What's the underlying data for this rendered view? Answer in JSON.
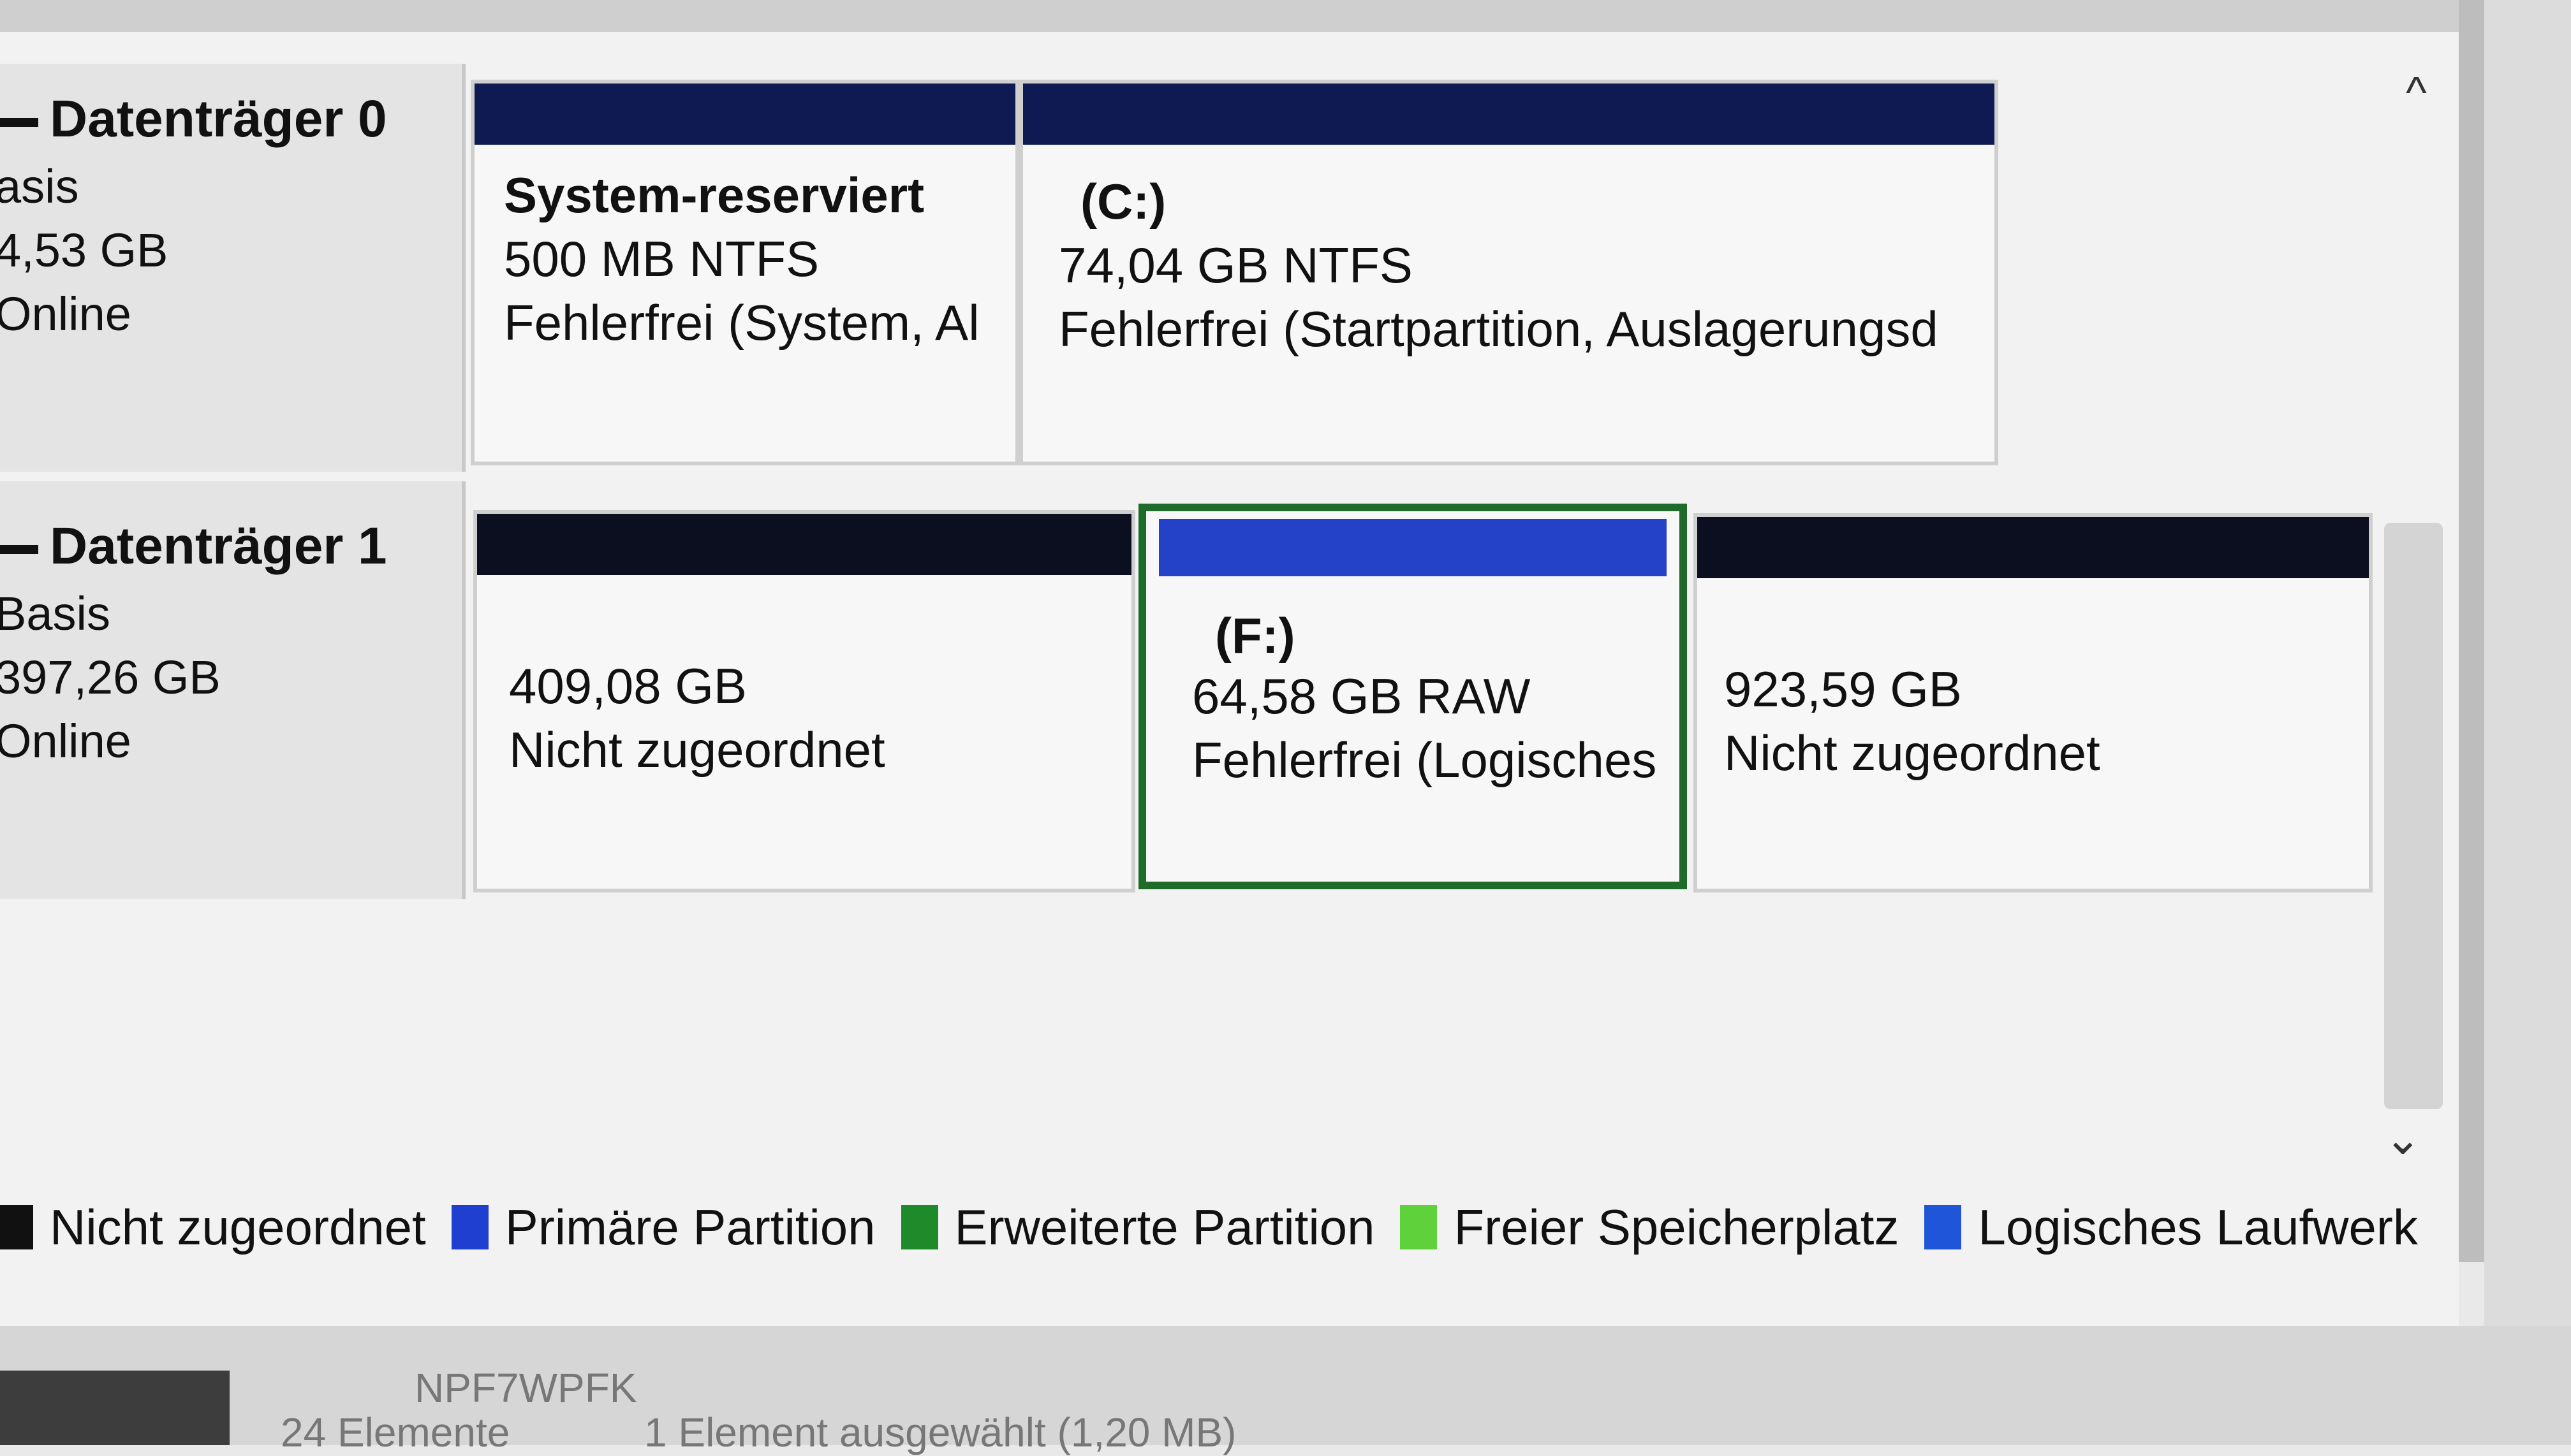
{
  "disks": [
    {
      "name": "Datenträger 0",
      "type": "asis",
      "size": "4,53 GB",
      "status": "Online",
      "partitions": [
        {
          "label": "System-reserviert",
          "size": "500 MB NTFS",
          "status": "Fehlerfrei (System, Al"
        },
        {
          "label": "(C:)",
          "size": "74,04 GB NTFS",
          "status": "Fehlerfrei (Startpartition, Auslagerungsd"
        }
      ]
    },
    {
      "name": "Datenträger 1",
      "type": "Basis",
      "size": "397,26 GB",
      "status": "Online",
      "partitions": [
        {
          "size": "409,08 GB",
          "status": "Nicht zugeordnet"
        },
        {
          "label": "(F:)",
          "size": "64,58 GB RAW",
          "status": "Fehlerfrei (Logisches"
        },
        {
          "size": "923,59 GB",
          "status": "Nicht zugeordnet"
        }
      ]
    }
  ],
  "legend": [
    {
      "label": "Nicht zugeordnet",
      "color": "#111111"
    },
    {
      "label": "Primäre Partition",
      "color": "#1f3fd1"
    },
    {
      "label": "Erweiterte Partition",
      "color": "#1f8a2a"
    },
    {
      "label": "Freier Speicherplatz",
      "color": "#5fd13a"
    },
    {
      "label": "Logisches Laufwerk",
      "color": "#1f55d8"
    }
  ],
  "colors": {
    "primary_bar": "#0f1a52",
    "unallocated_bar": "#0b0f1f",
    "logical_bar": "#2342c8",
    "selection_border": "#1f6b2a"
  },
  "statusbar": {
    "items": "24 Elemente",
    "selected": "1 Element ausgewählt (1,20 MB)",
    "folder": "NPF7WPFK"
  },
  "scrollbar": {
    "up_icon": "chevron-up-icon",
    "down_icon": "chevron-down-icon"
  }
}
